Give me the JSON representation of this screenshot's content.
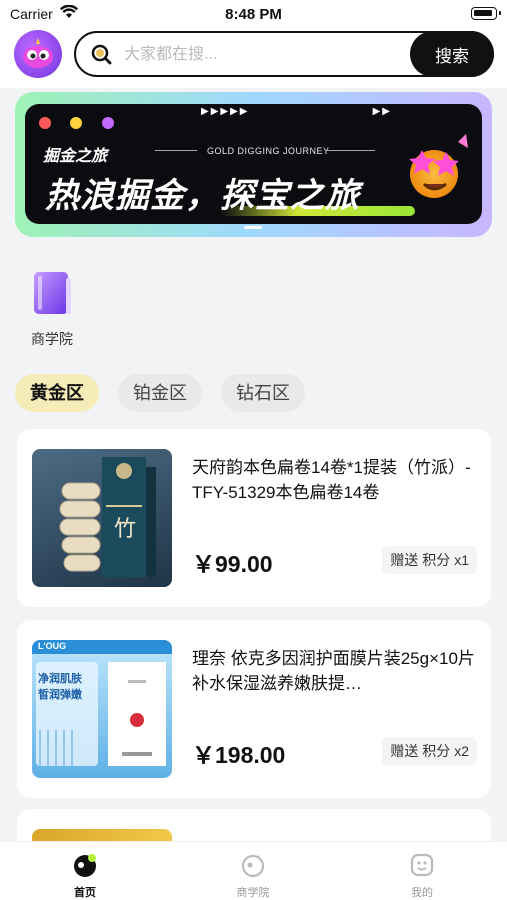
{
  "status_bar": {
    "carrier": "Carrier",
    "time": "8:48 PM"
  },
  "search": {
    "placeholder": "大家都在搜...",
    "value": "",
    "button_label": "搜索"
  },
  "banner": {
    "small_title": "掘金之旅",
    "subtitle": "GOLD DIGGING JOURNEY",
    "big_title": "热浪掘金，探宝之旅",
    "dot_colors": [
      "#ff5a5a",
      "#ffd23f",
      "#c46bff"
    ]
  },
  "quick_entry": {
    "label": "商学院",
    "icon": "book-icon"
  },
  "tabs": [
    {
      "label": "黄金区",
      "active": true
    },
    {
      "label": "铂金区",
      "active": false
    },
    {
      "label": "钻石区",
      "active": false
    }
  ],
  "products": [
    {
      "title": "天府韵本色扁卷14卷*1提装（竹派）-TFY-51329本色扁卷14卷",
      "price": "￥99.00",
      "badge": "赠送 积分 x1",
      "image_label": "竹"
    },
    {
      "title": "理奈 依克多因润护面膜片装25g×10片补水保湿滋养嫩肤提…",
      "price": "￥198.00",
      "badge": "赠送 积分 x2",
      "image_brand": "L'OUG",
      "image_line1": "净润肌肤",
      "image_line2": "皙润弹嫩"
    }
  ],
  "bottom_nav": [
    {
      "label": "首页",
      "icon": "home-icon",
      "active": true
    },
    {
      "label": "商学院",
      "icon": "academy-icon",
      "active": false
    },
    {
      "label": "我的",
      "icon": "profile-icon",
      "active": false
    }
  ],
  "colors": {
    "accent_tab": "#f6ecb8",
    "dark": "#111111",
    "background": "#f2f3f5"
  }
}
